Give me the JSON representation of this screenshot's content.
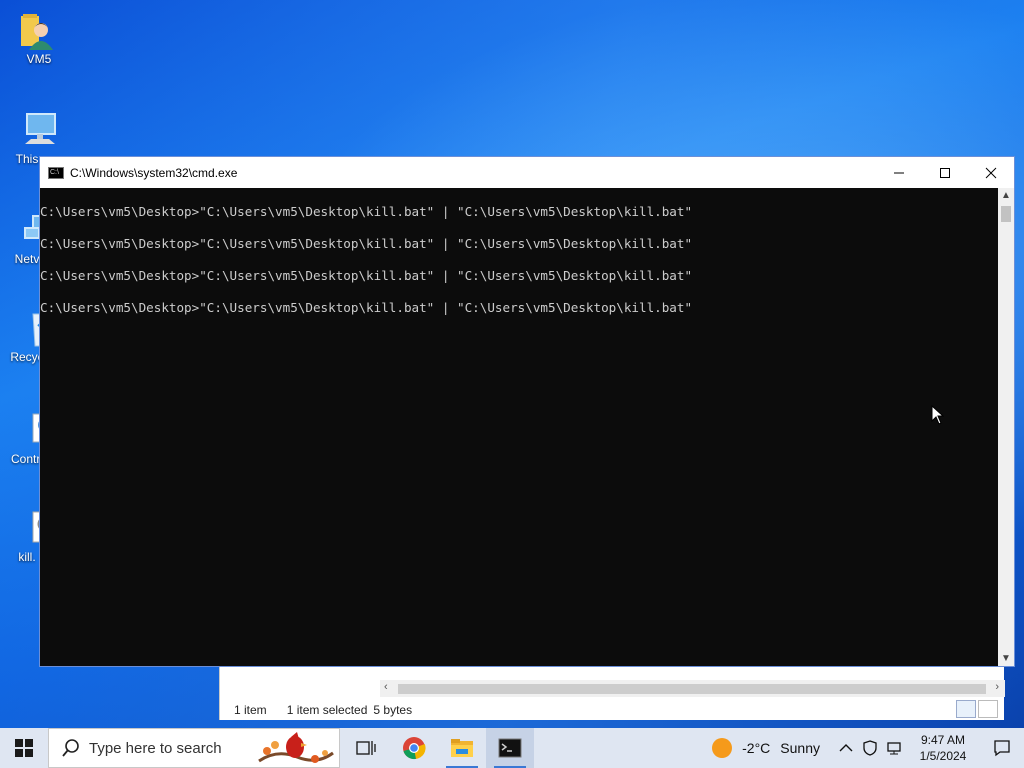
{
  "desktop": {
    "icons": [
      {
        "label": "VM5",
        "icon": "user-folder-icon"
      },
      {
        "label": "This",
        "icon": "this-pc-icon"
      },
      {
        "label": "Netv",
        "icon": "network-icon"
      },
      {
        "label": "Recyc",
        "icon": "recycle-bin-icon"
      },
      {
        "label": "Contro",
        "icon": "control-panel-icon"
      },
      {
        "label": "kill.",
        "icon": "batch-file-icon"
      }
    ]
  },
  "explorer": {
    "status_items": "1 item",
    "status_selected": "1 item selected",
    "status_size": "5 bytes"
  },
  "cmd": {
    "title": "C:\\Windows\\system32\\cmd.exe",
    "lines": [
      "C:\\Users\\vm5\\Desktop>\"C:\\Users\\vm5\\Desktop\\kill.bat\" | \"C:\\Users\\vm5\\Desktop\\kill.bat\"",
      "C:\\Users\\vm5\\Desktop>\"C:\\Users\\vm5\\Desktop\\kill.bat\" | \"C:\\Users\\vm5\\Desktop\\kill.bat\"",
      "C:\\Users\\vm5\\Desktop>\"C:\\Users\\vm5\\Desktop\\kill.bat\" | \"C:\\Users\\vm5\\Desktop\\kill.bat\"",
      "C:\\Users\\vm5\\Desktop>\"C:\\Users\\vm5\\Desktop\\kill.bat\" | \"C:\\Users\\vm5\\Desktop\\kill.bat\""
    ],
    "colors": {
      "background": "#0c0c0c",
      "text": "#cccccc"
    }
  },
  "taskbar": {
    "search_placeholder": "Type here to search",
    "apps": [
      {
        "name": "task-view",
        "icon": "task-view-icon"
      },
      {
        "name": "chrome",
        "icon": "chrome-icon"
      },
      {
        "name": "file-explorer",
        "icon": "folder-icon"
      },
      {
        "name": "command-prompt",
        "icon": "cmd-icon"
      }
    ],
    "weather": {
      "temp": "-2°C",
      "condition": "Sunny"
    },
    "clock": {
      "time": "9:47 AM",
      "date": "1/5/2024"
    }
  }
}
